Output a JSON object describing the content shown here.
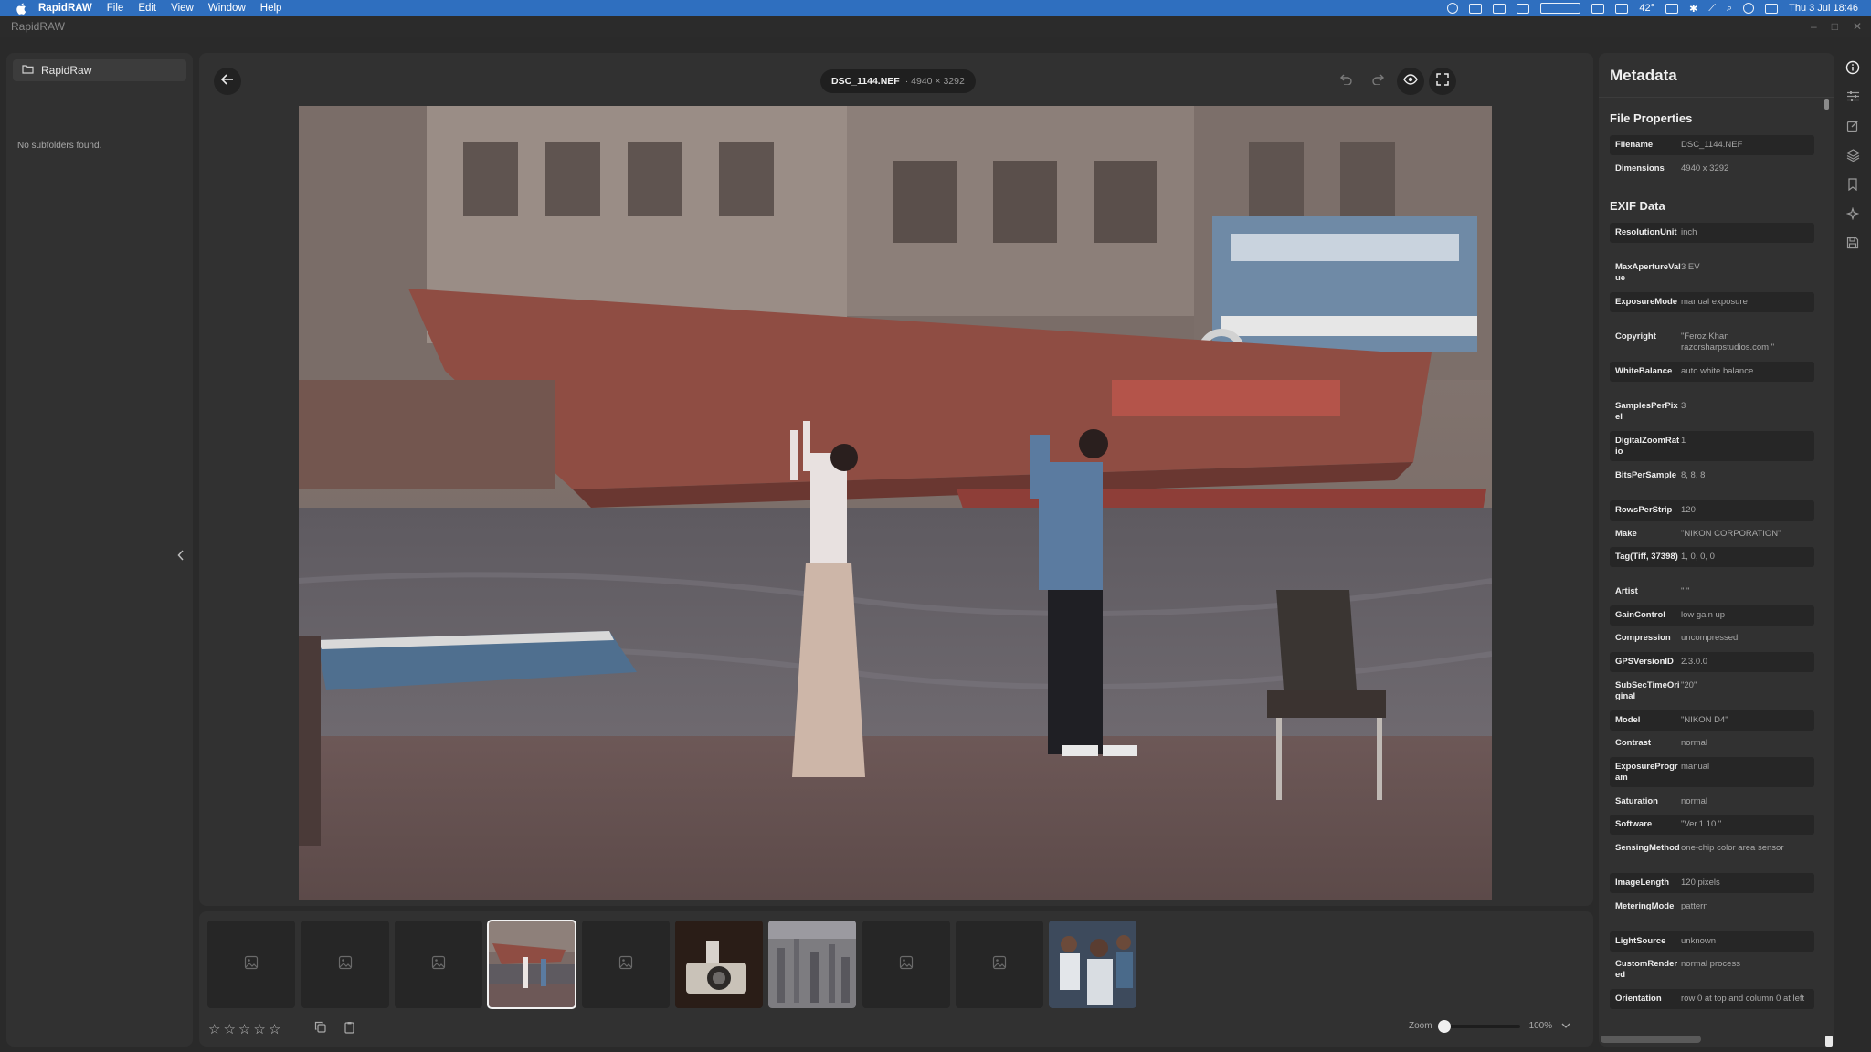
{
  "menubar": {
    "app_name": "RapidRAW",
    "items": [
      "File",
      "Edit",
      "View",
      "Window",
      "Help"
    ],
    "temperature": "42°",
    "clock": "Thu 3 Jul  18:46"
  },
  "window": {
    "title": "RapidRAW"
  },
  "left_panel": {
    "folder_name": "RapidRaw",
    "empty_message": "No subfolders found."
  },
  "editor": {
    "filename": "DSC_1144.NEF",
    "dimensions_label": "· 4940 × 3292"
  },
  "filmstrip": {
    "thumbnails": [
      {
        "kind": "placeholder"
      },
      {
        "kind": "placeholder"
      },
      {
        "kind": "placeholder"
      },
      {
        "kind": "photo-couple",
        "selected": true
      },
      {
        "kind": "placeholder"
      },
      {
        "kind": "photo-camera"
      },
      {
        "kind": "photo-city"
      },
      {
        "kind": "placeholder"
      },
      {
        "kind": "placeholder"
      },
      {
        "kind": "photo-people"
      }
    ],
    "rating_max": 5,
    "rating": 0,
    "zoom_label": "Zoom",
    "zoom_value": "100%"
  },
  "metadata": {
    "title": "Metadata",
    "file_properties_title": "File Properties",
    "file_properties": [
      {
        "key": "Filename",
        "value": "DSC_1144.NEF"
      },
      {
        "key": "Dimensions",
        "value": "4940 x 3292"
      }
    ],
    "exif_title": "EXIF Data",
    "exif": [
      {
        "key": "ResolutionUnit",
        "value": "inch"
      },
      {
        "key": "MaxApertureValue",
        "value": "3 EV"
      },
      {
        "key": "ExposureMode",
        "value": "manual exposure"
      },
      {
        "key": "Copyright",
        "value": "\"Feroz Khan razorsharpstudios.com \""
      },
      {
        "key": "WhiteBalance",
        "value": "auto white balance"
      },
      {
        "key": "SamplesPerPixel",
        "value": "3"
      },
      {
        "key": "DigitalZoomRatio",
        "value": "1"
      },
      {
        "key": "BitsPerSample",
        "value": "8, 8, 8"
      },
      {
        "key": "RowsPerStrip",
        "value": "120"
      },
      {
        "key": "Make",
        "value": "\"NIKON CORPORATION\""
      },
      {
        "key": "Tag(Tiff, 37398)",
        "value": "1, 0, 0, 0"
      },
      {
        "key": "Artist",
        "value": "\" \""
      },
      {
        "key": "GainControl",
        "value": "low gain up"
      },
      {
        "key": "Compression",
        "value": "uncompressed"
      },
      {
        "key": "GPSVersionID",
        "value": "2.3.0.0"
      },
      {
        "key": "SubSecTimeOriginal",
        "value": "\"20\""
      },
      {
        "key": "Model",
        "value": "\"NIKON D4\""
      },
      {
        "key": "Contrast",
        "value": "normal"
      },
      {
        "key": "ExposureProgram",
        "value": "manual"
      },
      {
        "key": "Saturation",
        "value": "normal"
      },
      {
        "key": "Software",
        "value": "\"Ver.1.10 \""
      },
      {
        "key": "SensingMethod",
        "value": "one-chip color area sensor"
      },
      {
        "key": "ImageLength",
        "value": "120 pixels"
      },
      {
        "key": "MeteringMode",
        "value": "pattern"
      },
      {
        "key": "LightSource",
        "value": "unknown"
      },
      {
        "key": "CustomRendered",
        "value": "normal process"
      },
      {
        "key": "Orientation",
        "value": "row 0 at top and column 0 at left"
      }
    ]
  }
}
